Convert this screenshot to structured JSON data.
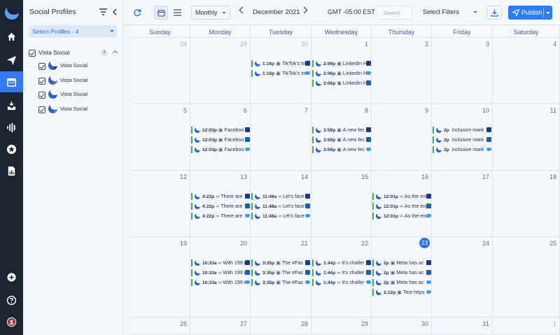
{
  "panel": {
    "title": "Social Profiles",
    "select_profiles": "Select Profiles - 4",
    "group": {
      "label": "Vista Social",
      "count": "4"
    },
    "profiles": [
      {
        "label": "Vista Social",
        "network": "facebook"
      },
      {
        "label": "Vista Social",
        "network": "instagram"
      },
      {
        "label": "Vista Social",
        "network": "linkedin"
      },
      {
        "label": "Vista Social",
        "network": "twitter"
      }
    ]
  },
  "toolbar": {
    "view": "Monthly",
    "month": "December 2021",
    "timezone": "GMT -05:00 EST",
    "search_placeholder": "Search",
    "filters": "Select Filters",
    "publish": "Publish"
  },
  "calendar": {
    "weekdays": [
      "Sunday",
      "Monday",
      "Tuesday",
      "Wednesday",
      "Thursday",
      "Friday",
      "Saturday"
    ],
    "weeks": [
      [
        {
          "day": "28",
          "dim": true,
          "events": []
        },
        {
          "day": "29",
          "dim": true,
          "events": []
        },
        {
          "day": "30",
          "dim": true,
          "events": [
            {
              "time": "1:16p",
              "kind": "camera",
              "text": "TikTok's tre",
              "net": "fb"
            },
            {
              "time": "1:16p",
              "kind": "camera",
              "text": "TikTok's tre",
              "net": "tw"
            }
          ]
        },
        {
          "day": "1",
          "events": [
            {
              "time": "2:06p",
              "kind": "camera",
              "text": "LinkedIn H",
              "net": "fb"
            },
            {
              "time": "2:06p",
              "kind": "camera",
              "text": "LinkedIn H",
              "net": "tw"
            },
            {
              "time": "2:06p",
              "kind": "camera",
              "text": "LinkedIn H",
              "net": "li"
            }
          ]
        },
        {
          "day": "2",
          "events": []
        },
        {
          "day": "3",
          "events": []
        },
        {
          "day": "4",
          "events": []
        }
      ],
      [
        {
          "day": "5",
          "events": []
        },
        {
          "day": "6",
          "events": [
            {
              "time": "12:03p",
              "kind": "camera",
              "text": "Faceboo",
              "net": "fb"
            },
            {
              "time": "12:03p",
              "kind": "camera",
              "text": "Faceboo",
              "net": "li"
            },
            {
              "time": "12:03p",
              "kind": "camera",
              "text": "Faceboo",
              "net": "tw"
            }
          ]
        },
        {
          "day": "7",
          "events": []
        },
        {
          "day": "8",
          "events": [
            {
              "time": "3:59p",
              "kind": "camera",
              "text": "A new fec",
              "net": "fb"
            },
            {
              "time": "3:59p",
              "kind": "camera",
              "text": "A new fec",
              "net": "li"
            },
            {
              "time": "3:59p",
              "kind": "camera",
              "text": "A new fec",
              "net": "tw"
            }
          ]
        },
        {
          "day": "9",
          "events": []
        },
        {
          "day": "10",
          "events": [
            {
              "time": "2p",
              "kind": "",
              "text": "inclusive mark",
              "net": "fb"
            },
            {
              "time": "2p",
              "kind": "",
              "text": "inclusive mark",
              "net": "li"
            },
            {
              "time": "2p",
              "kind": "",
              "text": "inclusive mark",
              "net": "tw"
            }
          ]
        },
        {
          "day": "11",
          "events": []
        }
      ],
      [
        {
          "day": "12",
          "events": []
        },
        {
          "day": "13",
          "events": [
            {
              "time": "4:22p",
              "kind": "link",
              "text": "There are",
              "net": "fb"
            },
            {
              "time": "4:22p",
              "kind": "link",
              "text": "There are",
              "net": "li"
            },
            {
              "time": "4:22p",
              "kind": "link",
              "text": "There are",
              "net": "tw"
            }
          ]
        },
        {
          "day": "14",
          "events": [
            {
              "time": "11:48a",
              "kind": "link",
              "text": "Let's face",
              "net": "fb"
            },
            {
              "time": "11:48a",
              "kind": "link",
              "text": "Let's face",
              "net": "li"
            },
            {
              "time": "11:48a",
              "kind": "link",
              "text": "Let's face",
              "net": "tw"
            }
          ]
        },
        {
          "day": "15",
          "events": []
        },
        {
          "day": "16",
          "events": [
            {
              "time": "12:01p",
              "kind": "link",
              "text": "As the enc",
              "net": "fb"
            },
            {
              "time": "12:01p",
              "kind": "link",
              "text": "As the enc",
              "net": "li"
            },
            {
              "time": "12:01p",
              "kind": "link",
              "text": "As the enc",
              "net": "tw"
            }
          ]
        },
        {
          "day": "17",
          "events": []
        },
        {
          "day": "18",
          "events": []
        }
      ],
      [
        {
          "day": "19",
          "events": []
        },
        {
          "day": "20",
          "events": [
            {
              "time": "10:33a",
              "kind": "link",
              "text": "With 199 r",
              "net": "fb"
            },
            {
              "time": "10:33a",
              "kind": "link",
              "text": "With 199 r",
              "net": "li"
            },
            {
              "time": "10:33a",
              "kind": "link",
              "text": "With 199 r",
              "net": "tw"
            }
          ]
        },
        {
          "day": "21",
          "events": [
            {
              "time": "3:35p",
              "kind": "camera",
              "text": "The #Fac",
              "net": "fb"
            },
            {
              "time": "3:35p",
              "kind": "camera",
              "text": "The #Fac",
              "net": "li"
            },
            {
              "time": "3:35p",
              "kind": "camera",
              "text": "The #Fac",
              "net": "tw"
            }
          ]
        },
        {
          "day": "22",
          "events": [
            {
              "time": "1:44p",
              "kind": "link",
              "text": "It's challer",
              "net": "fb"
            },
            {
              "time": "1:44p",
              "kind": "link",
              "text": "It's challer",
              "net": "li"
            },
            {
              "time": "1:44p",
              "kind": "link",
              "text": "It's challer",
              "net": "tw"
            }
          ]
        },
        {
          "day": "23",
          "today": true,
          "events": [
            {
              "time": "2p",
              "kind": "camera",
              "text": "Meta has ac",
              "net": "fb"
            },
            {
              "time": "2p",
              "kind": "camera",
              "text": "Meta has ac",
              "net": "li"
            },
            {
              "time": "2p",
              "kind": "camera",
              "text": "Meta has ac",
              "net": "tw"
            },
            {
              "time": "2:12p",
              "kind": "camera",
              "text": "Test https",
              "net": "tw"
            }
          ]
        },
        {
          "day": "24",
          "events": []
        },
        {
          "day": "25",
          "events": []
        }
      ],
      [
        {
          "day": "26",
          "events": []
        },
        {
          "day": "27",
          "events": []
        },
        {
          "day": "28",
          "events": []
        },
        {
          "day": "29",
          "events": []
        },
        {
          "day": "30",
          "events": []
        },
        {
          "day": "31",
          "events": []
        },
        {
          "day": "1",
          "dim": true,
          "events": []
        }
      ]
    ]
  },
  "colors": {
    "accent": "#2f7df6",
    "nav_bg": "#1c2331",
    "today": "#2f6fe8",
    "event_bar": "#3fae5a"
  }
}
